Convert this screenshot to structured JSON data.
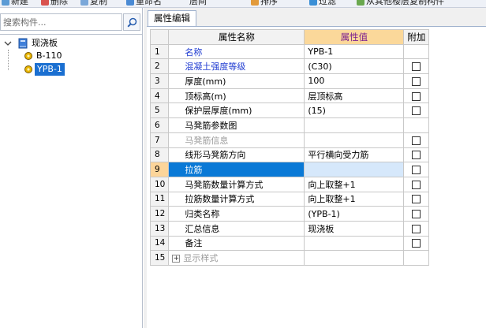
{
  "toolbar": {
    "items": [
      "新建",
      "删除",
      "复制",
      "重命名",
      "层间",
      "排序",
      "过滤",
      "从其他楼层复制构件"
    ]
  },
  "left_panel": {
    "search_placeholder": "搜索构件...",
    "tree": {
      "root_label": "现浇板",
      "children": [
        {
          "label": "B-110"
        },
        {
          "label": "YPB-1"
        }
      ]
    }
  },
  "properties": {
    "tab_label": "属性编辑",
    "headers": {
      "name": "属性名称",
      "value": "属性值",
      "extra": "附加"
    },
    "rows": [
      {
        "no": "1",
        "name": "名称",
        "value": "YPB-1",
        "style": "blue",
        "checkbox": false
      },
      {
        "no": "2",
        "name": "混凝土强度等级",
        "value": "(C30)",
        "style": "blue",
        "checkbox": true
      },
      {
        "no": "3",
        "name": "厚度(mm)",
        "value": "100",
        "style": "",
        "checkbox": true
      },
      {
        "no": "4",
        "name": "顶标高(m)",
        "value": "层顶标高",
        "style": "",
        "checkbox": true
      },
      {
        "no": "5",
        "name": "保护层厚度(mm)",
        "value": "(15)",
        "style": "",
        "checkbox": true
      },
      {
        "no": "6",
        "name": "马凳筋参数图",
        "value": "",
        "style": "",
        "checkbox": false
      },
      {
        "no": "7",
        "name": "马凳筋信息",
        "value": "",
        "style": "gray",
        "checkbox": true
      },
      {
        "no": "8",
        "name": "线形马凳筋方向",
        "value": "平行横向受力筋",
        "style": "",
        "checkbox": true
      },
      {
        "no": "9",
        "name": "拉筋",
        "value": "",
        "style": "",
        "checkbox": true,
        "selected": true
      },
      {
        "no": "10",
        "name": "马凳筋数量计算方式",
        "value": "向上取整+1",
        "style": "",
        "checkbox": true
      },
      {
        "no": "11",
        "name": "拉筋数量计算方式",
        "value": "向上取整+1",
        "style": "",
        "checkbox": true
      },
      {
        "no": "12",
        "name": "归类名称",
        "value": "(YPB-1)",
        "style": "",
        "checkbox": true
      },
      {
        "no": "13",
        "name": "汇总信息",
        "value": "现浇板",
        "style": "",
        "checkbox": true
      },
      {
        "no": "14",
        "name": "备注",
        "value": "",
        "style": "",
        "checkbox": true
      },
      {
        "no": "15",
        "name": "显示样式",
        "value": "",
        "style": "gray",
        "checkbox": false,
        "expandable": true
      }
    ]
  },
  "colors": {
    "value_header_bg": "#fbd89a",
    "value_header_text": "#7a1d8f",
    "link_blue": "#1f3bd1",
    "selection_blue": "#0a79d6"
  }
}
